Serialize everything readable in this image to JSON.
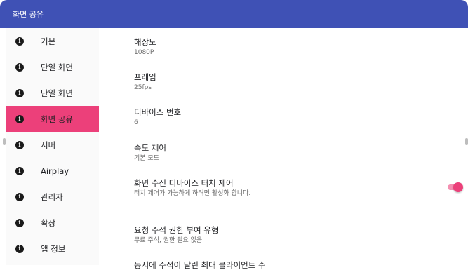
{
  "window": {
    "title": "화면 공유"
  },
  "sidebar": {
    "items": [
      {
        "label": "기본",
        "icon": "info-icon"
      },
      {
        "label": "단일 화면",
        "icon": "info-icon"
      },
      {
        "label": "단일 화면",
        "icon": "info-icon"
      },
      {
        "label": "화면 공유",
        "icon": "info-icon",
        "selected": true
      },
      {
        "label": "서버",
        "icon": "info-icon"
      },
      {
        "label": "Airplay",
        "icon": "info-icon"
      },
      {
        "label": "관리자",
        "icon": "info-icon"
      },
      {
        "label": "확장",
        "icon": "info-icon"
      },
      {
        "label": "앱 정보",
        "icon": "info-icon"
      }
    ],
    "selected_color": "#ec407a"
  },
  "main": {
    "prefs": [
      {
        "title": "해상도",
        "summary": "1080P"
      },
      {
        "title": "프레임",
        "summary": "25fps"
      },
      {
        "title": "디바이스 번호",
        "summary": "6"
      },
      {
        "title": "속도 제어",
        "summary": "기본 모드"
      },
      {
        "title": "화면 수신 디바이스 터치 제어",
        "summary": "터치 제어가 가능하게 하려면 활성화 합니다.",
        "switch_on": true
      },
      {
        "title": "요청 주석 권한 부여 유형",
        "summary": "무료 주석, 권한 필요 없음"
      },
      {
        "title": "동시에 주석이 달린 최대 클라이언트 수",
        "summary": ""
      }
    ]
  },
  "colors": {
    "titlebar": "#3f51b5",
    "accent": "#ec407a"
  }
}
